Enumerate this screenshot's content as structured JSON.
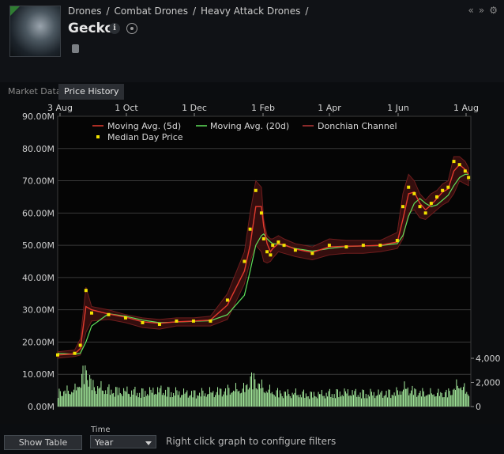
{
  "header": {
    "breadcrumb": [
      "Drones",
      "/",
      "Combat Drones",
      "/",
      "Heavy Attack Drones",
      "/"
    ],
    "title": "Gecko",
    "nav_icons": [
      "«",
      "»",
      "⚙"
    ]
  },
  "tabs": [
    {
      "label": "Market Data",
      "active": false
    },
    {
      "label": "Price History",
      "active": true
    }
  ],
  "bottom": {
    "show_table_label": "Show Table",
    "time_label": "Time",
    "time_value": "Year",
    "hint": "Right click graph to configure filters"
  },
  "colors": {
    "ma5": "#e33b2e",
    "ma20": "#5fe05a",
    "donchian": "#7a2020",
    "median": "#f2e200",
    "volume": "#a8f0a0"
  },
  "chart_data": {
    "type": "line",
    "x_tick_labels": [
      "3 Aug",
      "1 Oct",
      "1 Dec",
      "1 Feb",
      "1 Apr",
      "1 Jun",
      "1 Aug"
    ],
    "y_tick_labels": [
      "0.00M",
      "10.00M",
      "20.00M",
      "30.00M",
      "40.00M",
      "50.00M",
      "60.00M",
      "70.00M",
      "80.00M",
      "90.00M"
    ],
    "ylim": [
      0,
      90
    ],
    "y_unit": "M",
    "volume_tick_labels": [
      "0",
      "2,000",
      "4,000"
    ],
    "volume_ylim": [
      0,
      4000
    ],
    "legend": {
      "placement": "top",
      "entries": [
        "Moving Avg. (5d)",
        "Moving Avg. (20d)",
        "Donchian Channel",
        "Median Day Price"
      ]
    },
    "x_days": [
      0,
      15,
      20,
      25,
      30,
      45,
      60,
      75,
      90,
      105,
      120,
      135,
      150,
      165,
      170,
      175,
      180,
      182,
      185,
      188,
      190,
      195,
      200,
      210,
      225,
      240,
      255,
      270,
      285,
      300,
      305,
      310,
      315,
      320,
      325,
      330,
      335,
      340,
      345,
      350,
      355,
      360,
      363
    ],
    "median_price": [
      16.0,
      16.5,
      19.0,
      36.0,
      29.0,
      28.5,
      27.5,
      26.0,
      25.5,
      26.5,
      26.5,
      26.5,
      33.0,
      45.0,
      55.0,
      67.0,
      60.0,
      52.0,
      48.0,
      47.0,
      50.0,
      51.0,
      50.0,
      48.5,
      47.5,
      50.0,
      49.5,
      50.0,
      50.0,
      51.5,
      62.0,
      68.0,
      66.0,
      62.0,
      60.0,
      63.0,
      65.0,
      67.0,
      68.0,
      76.0,
      75.0,
      73.0,
      71.0
    ],
    "ma5": [
      16.0,
      16.3,
      18.0,
      31.0,
      30.0,
      28.7,
      27.7,
      26.3,
      25.8,
      26.3,
      26.5,
      26.8,
      31.5,
      42.0,
      50.0,
      62.0,
      62.0,
      56.0,
      50.5,
      48.0,
      49.0,
      50.5,
      50.2,
      48.8,
      47.8,
      49.5,
      49.7,
      49.8,
      50.0,
      51.0,
      58.0,
      66.0,
      66.5,
      63.0,
      61.0,
      62.5,
      64.5,
      66.5,
      67.5,
      73.0,
      75.0,
      73.5,
      72.0
    ],
    "ma20": [
      16.5,
      16.2,
      16.5,
      20.0,
      25.0,
      28.8,
      28.0,
      26.8,
      26.0,
      26.2,
      26.4,
      26.6,
      28.5,
      34.5,
      42.0,
      50.0,
      53.0,
      53.5,
      52.0,
      51.0,
      50.5,
      50.3,
      50.0,
      49.0,
      48.2,
      49.0,
      49.6,
      49.8,
      49.9,
      50.5,
      53.0,
      59.0,
      63.0,
      64.5,
      63.0,
      62.0,
      62.5,
      64.0,
      65.5,
      68.5,
      71.0,
      72.0,
      72.0
    ],
    "donchian_high": [
      17.0,
      17.5,
      21.0,
      37.0,
      31.0,
      30.0,
      28.5,
      27.5,
      27.0,
      27.5,
      27.5,
      28.0,
      35.0,
      48.0,
      60.0,
      70.0,
      68.0,
      58.0,
      53.0,
      52.0,
      52.0,
      53.0,
      52.0,
      50.5,
      49.5,
      52.0,
      51.5,
      51.5,
      51.5,
      54.0,
      66.0,
      72.0,
      70.0,
      66.0,
      64.0,
      66.0,
      67.0,
      69.0,
      70.0,
      77.5,
      77.5,
      76.0,
      74.0
    ],
    "donchian_low": [
      15.0,
      15.5,
      16.0,
      23.0,
      26.5,
      27.0,
      26.0,
      24.5,
      24.0,
      25.0,
      25.0,
      25.0,
      27.0,
      38.0,
      45.0,
      50.0,
      48.0,
      45.0,
      44.5,
      45.0,
      46.0,
      48.0,
      47.5,
      46.5,
      45.5,
      47.0,
      47.5,
      47.5,
      48.0,
      49.0,
      52.0,
      60.0,
      61.0,
      58.5,
      58.0,
      59.5,
      61.0,
      62.5,
      63.5,
      66.0,
      70.0,
      69.0,
      68.5
    ],
    "volume": [
      1300,
      1500,
      2400,
      3500,
      1900,
      1500,
      1400,
      1300,
      1500,
      1300,
      1200,
      1300,
      1500,
      1600,
      2600,
      2300,
      1800,
      1600,
      1500,
      1400,
      1300,
      1300,
      1200,
      1200,
      1100,
      1200,
      1300,
      1200,
      1200,
      1300,
      1700,
      1600,
      1400,
      1300,
      1200,
      1200,
      1200,
      1200,
      1300,
      1600,
      2100,
      1400,
      1200
    ]
  }
}
